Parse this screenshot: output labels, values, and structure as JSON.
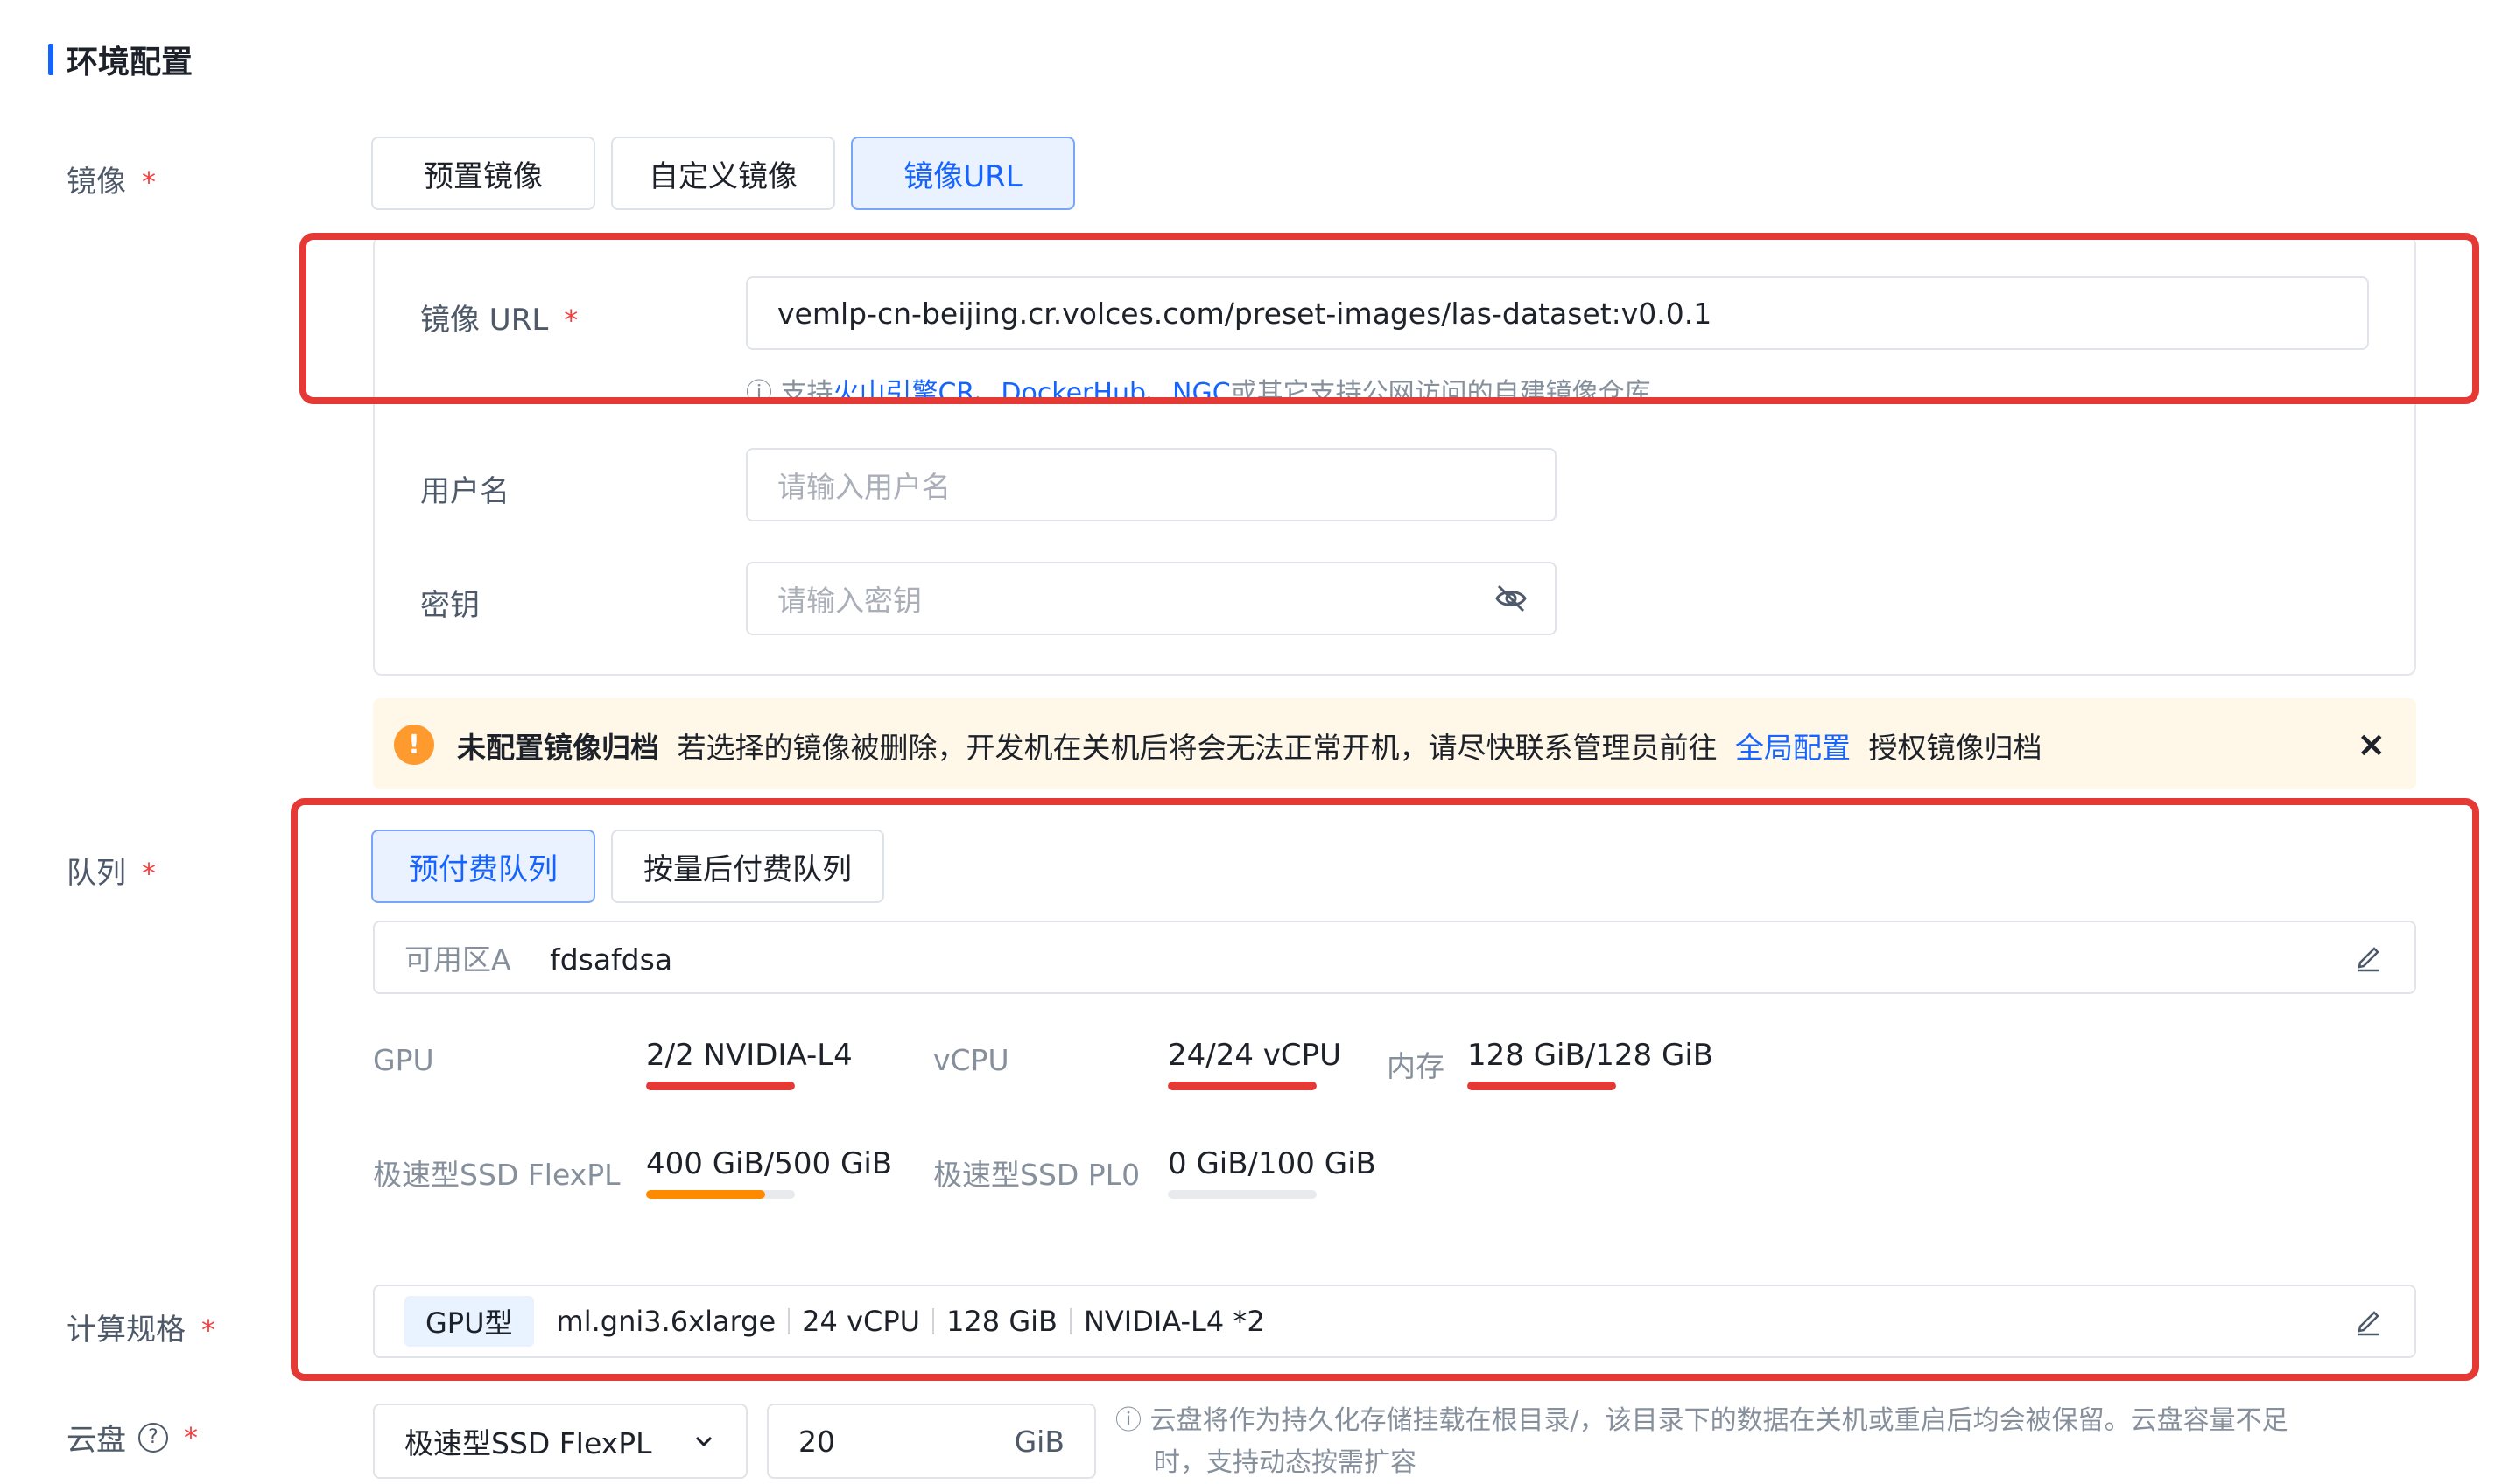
{
  "section": {
    "title": "环境配置"
  },
  "image": {
    "label": "镜像",
    "required_mark": "*",
    "tabs": [
      {
        "label": "预置镜像",
        "active": false
      },
      {
        "label": "自定义镜像",
        "active": false
      },
      {
        "label": "镜像URL",
        "active": true
      }
    ],
    "url": {
      "label": "镜像 URL",
      "value": "vemlp-cn-beijing.cr.volces.com/preset-images/las-dataset:v0.0.1",
      "hint_prefix": "支持",
      "hint_link1": "火山引擎CR",
      "hint_sep1": "、",
      "hint_link2": "DockerHub",
      "hint_sep2": "、",
      "hint_link3": "NGC",
      "hint_suffix": "或其它支持公网访问的自建镜像仓库"
    },
    "username": {
      "label": "用户名",
      "placeholder": "请输入用户名"
    },
    "secret": {
      "label": "密钥",
      "placeholder": "请输入密钥"
    }
  },
  "warning": {
    "icon": "!",
    "title": "未配置镜像归档",
    "text": "若选择的镜像被删除，开发机在关机后将会无法正常开机，请尽快联系管理员前往",
    "link": "全局配置",
    "suffix": "授权镜像归档",
    "close": "×"
  },
  "queue": {
    "label": "队列",
    "required_mark": "*",
    "tabs": [
      {
        "label": "预付费队列",
        "active": true
      },
      {
        "label": "按量后付费队列",
        "active": false
      }
    ],
    "zone_label": "可用区A",
    "zone_value": "fdsafdsa",
    "metrics": [
      {
        "label": "GPU",
        "value": "2/2 NVIDIA-L4",
        "fill": 1.0,
        "color": "#e53935"
      },
      {
        "label": "vCPU",
        "value": "24/24 vCPU",
        "fill": 1.0,
        "color": "#e53935"
      },
      {
        "label": "内存",
        "value": "128 GiB/128 GiB",
        "fill": 1.0,
        "color": "#e53935"
      },
      {
        "label": "极速型SSD FlexPL",
        "value": "400 GiB/500 GiB",
        "fill": 0.8,
        "color": "#ff8a00"
      },
      {
        "label": "极速型SSD PL0",
        "value": "0 GiB/100 GiB",
        "fill": 0.0,
        "color": "#1664ff"
      }
    ]
  },
  "spec": {
    "label": "计算规格",
    "required_mark": "*",
    "tag": "GPU型",
    "name": "ml.gni3.6xlarge",
    "vcpu": "24 vCPU",
    "mem": "128 GiB",
    "gpu": "NVIDIA-L4 *2"
  },
  "disk": {
    "label": "云盘",
    "help_icon": "?",
    "required_mark": "*",
    "type": "极速型SSD FlexPL",
    "size": "20",
    "unit": "GiB",
    "hint_line1": "云盘将作为持久化存储挂载在根目录/，该目录下的数据在关机或重启后均会被保留。云盘容量不足",
    "hint_line2": "时，支持动态按需扩容"
  }
}
